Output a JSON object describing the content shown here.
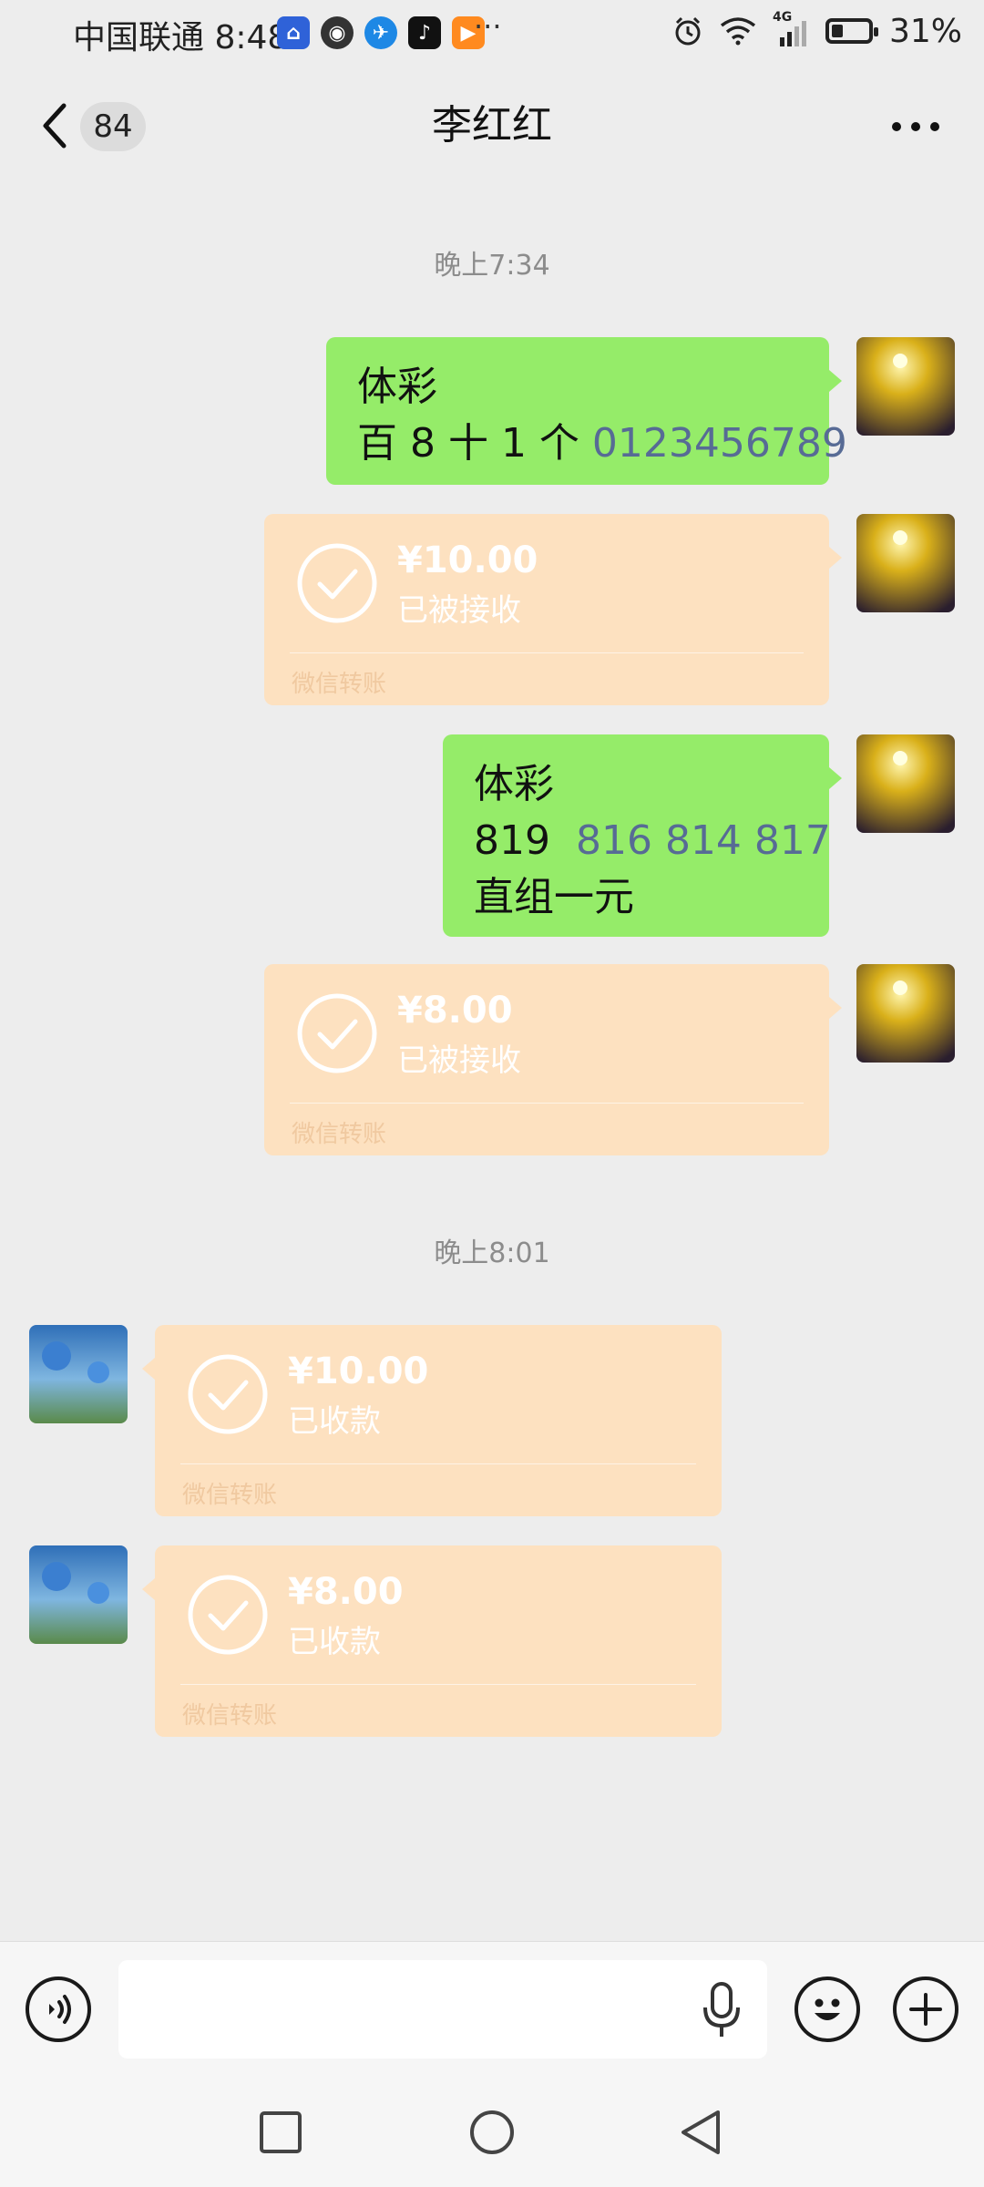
{
  "status_bar": {
    "carrier_time": "中国联通 8:48",
    "more": "···",
    "network": "4G",
    "battery": "31%"
  },
  "header": {
    "unread_count": "84",
    "title": "李红红",
    "more": "···"
  },
  "messages": {
    "time1": "晚上7:34",
    "msg1_line1": "体彩",
    "msg1_line2_prefix": "百 8 十 1 个 ",
    "msg1_line2_number": "0123456789",
    "transfer1": {
      "amount": "¥10.00",
      "status": "已被接收",
      "source": "微信转账"
    },
    "msg2_line1": "体彩",
    "msg2_line2_prefix": "819  ",
    "msg2_line2_numbers": "816 814 817",
    "msg2_line3": "直组一元",
    "transfer2": {
      "amount": "¥8.00",
      "status": "已被接收",
      "source": "微信转账"
    },
    "time2": "晚上8:01",
    "transfer3": {
      "amount": "¥10.00",
      "status": "已收款",
      "source": "微信转账"
    },
    "transfer4": {
      "amount": "¥8.00",
      "status": "已收款",
      "source": "微信转账"
    }
  },
  "input": {
    "placeholder": ""
  },
  "colors": {
    "background": "#ededed",
    "sent_bubble": "#95ec69",
    "transfer_card": "#fde1c0",
    "link_blue": "#576b95"
  }
}
